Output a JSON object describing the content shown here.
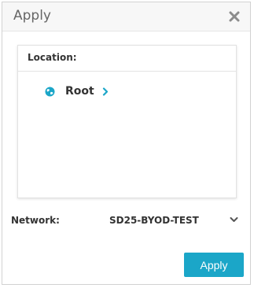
{
  "dialog": {
    "title": "Apply",
    "close_icon": "close-icon"
  },
  "location": {
    "label": "Location:",
    "tree": [
      {
        "label": "Root",
        "icon": "globe-icon",
        "expand_icon": "chevron-right-icon"
      }
    ]
  },
  "network": {
    "label": "Network:",
    "selected": "SD25-BYOD-TEST",
    "dropdown_icon": "chevron-down-icon"
  },
  "actions": {
    "apply_label": "Apply"
  },
  "colors": {
    "accent": "#1ba6c8",
    "text": "#333333",
    "title": "#666666",
    "header_bg": "#f7f7f7",
    "border": "#d2d2d2"
  }
}
